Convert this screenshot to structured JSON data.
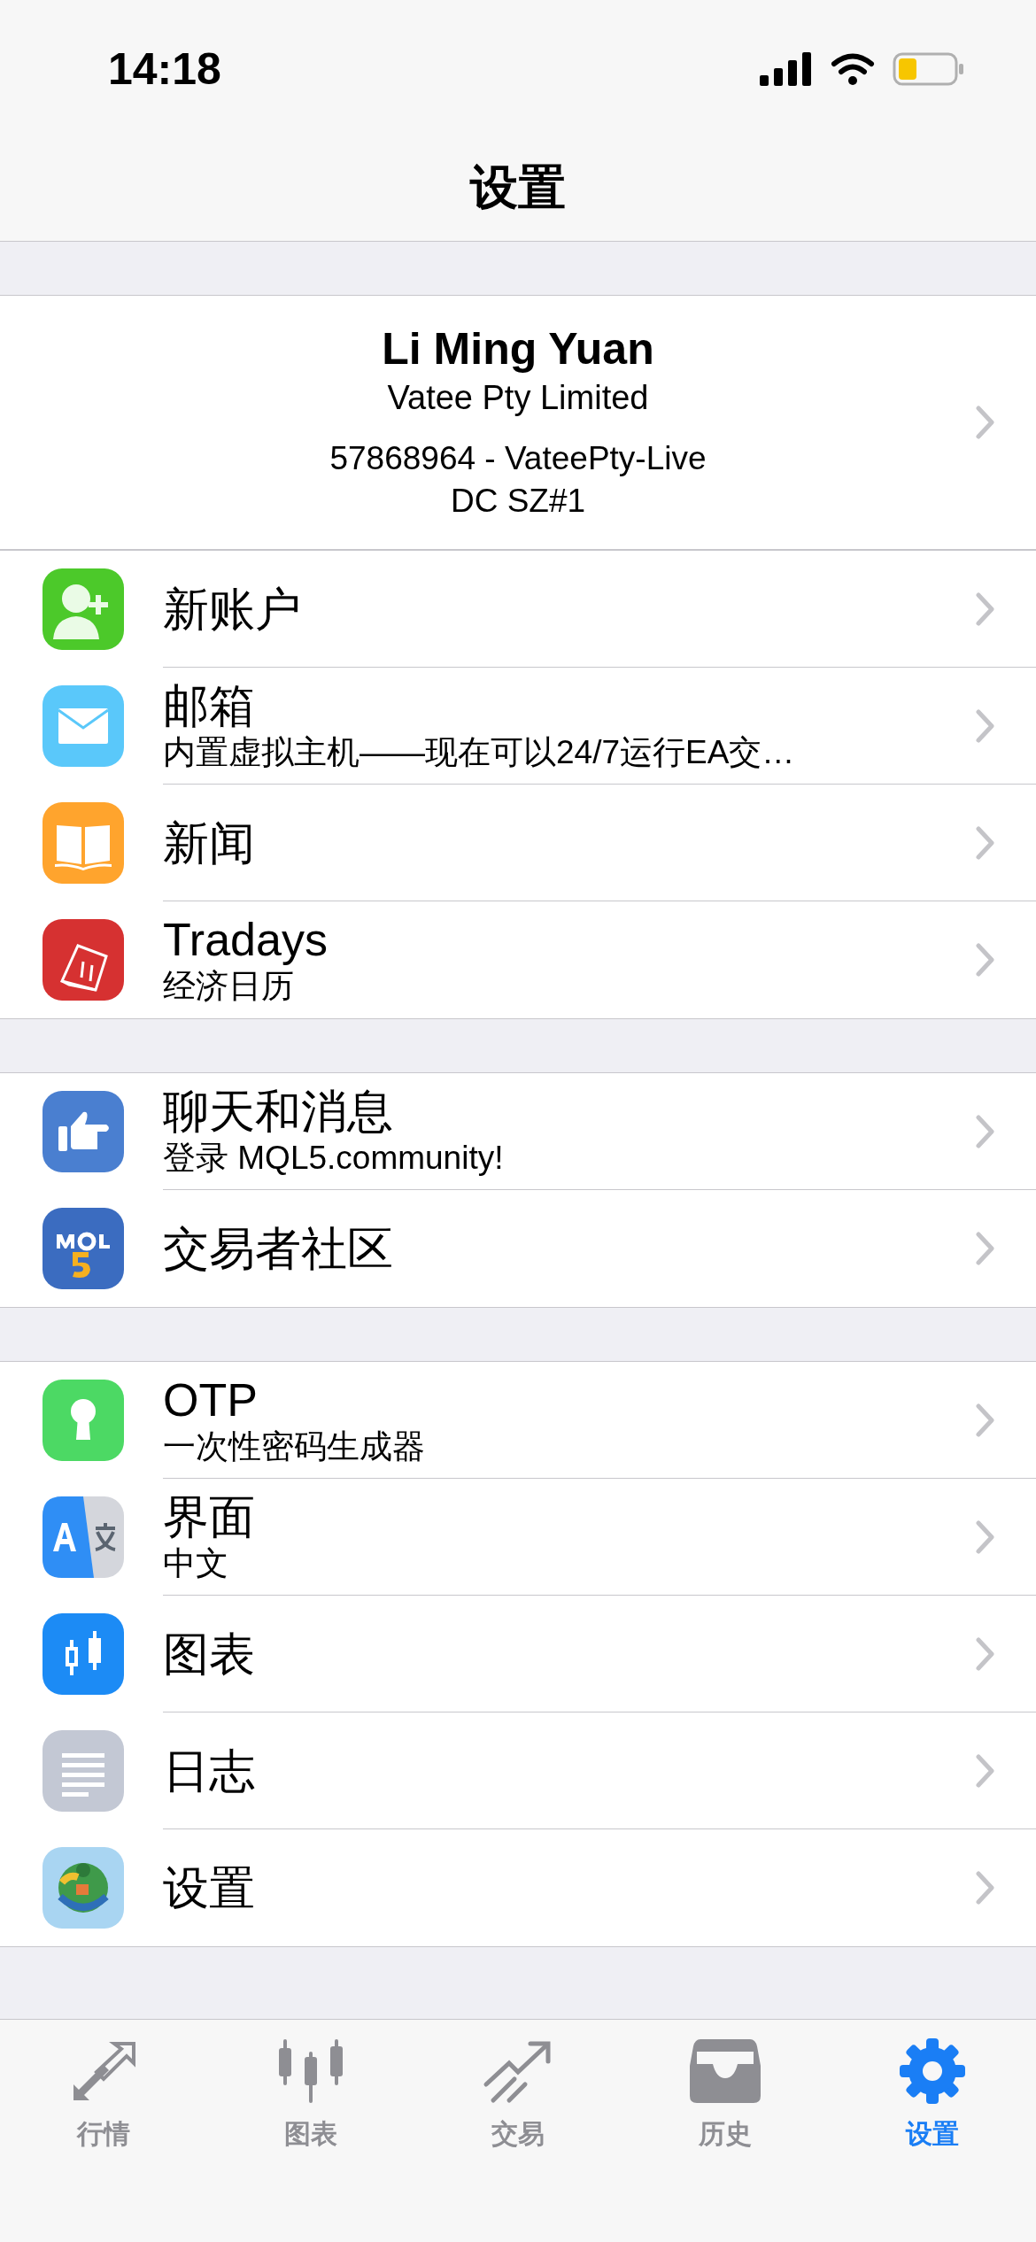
{
  "status_bar": {
    "time": "14:18"
  },
  "nav": {
    "title": "设置"
  },
  "account": {
    "name": "Li Ming Yuan",
    "company": "Vatee Pty Limited",
    "login": "57868964 - VateePty-Live",
    "server": "DC SZ#1"
  },
  "sections": [
    {
      "items": [
        {
          "title": "新账户"
        },
        {
          "title": "邮箱",
          "subtitle": "内置虚拟主机——现在可以24/7运行EA交…"
        },
        {
          "title": "新闻"
        },
        {
          "title": "Tradays",
          "subtitle": "经济日历"
        }
      ]
    },
    {
      "items": [
        {
          "title": "聊天和消息",
          "subtitle": "登录 MQL5.community!"
        },
        {
          "title": "交易者社区"
        }
      ]
    },
    {
      "items": [
        {
          "title": "OTP",
          "subtitle": "一次性密码生成器"
        },
        {
          "title": "界面",
          "subtitle": "中文"
        },
        {
          "title": "图表"
        },
        {
          "title": "日志"
        },
        {
          "title": "设置"
        }
      ]
    }
  ],
  "tab_bar": [
    {
      "label": "行情",
      "selected": false
    },
    {
      "label": "图表",
      "selected": false
    },
    {
      "label": "交易",
      "selected": false
    },
    {
      "label": "历史",
      "selected": false
    },
    {
      "label": "设置",
      "selected": true
    }
  ]
}
